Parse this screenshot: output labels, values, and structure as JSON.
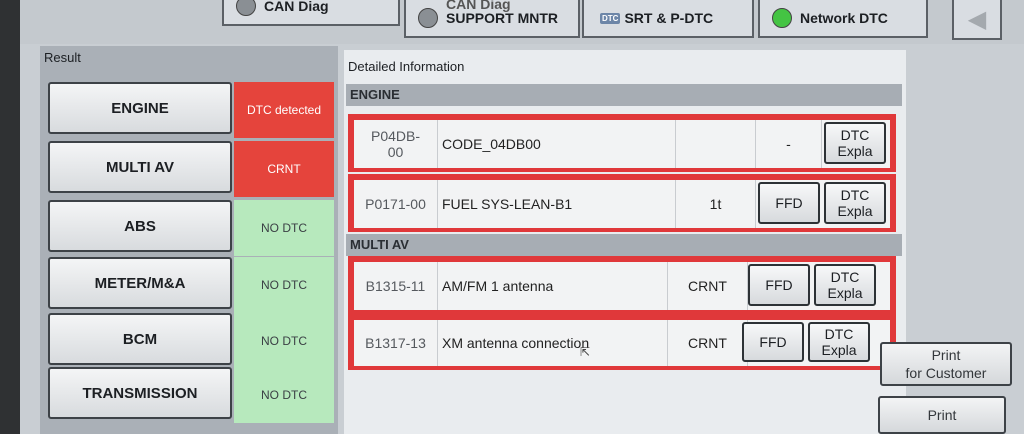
{
  "tabs": [
    {
      "label": "CAN Diag",
      "lamp_color": "#8a8f94"
    },
    {
      "label_line1": "CAN Diag",
      "label_line2": "SUPPORT MNTR",
      "lamp_color": "#8a8f94"
    },
    {
      "icon_text": "DTC",
      "label": "SRT & P-DTC"
    },
    {
      "label": "Network DTC",
      "lamp_color": "#44c443"
    }
  ],
  "result_panel": {
    "title": "Result",
    "rows": [
      {
        "ecu": "ENGINE",
        "status": "DTC detected",
        "status_color": "red"
      },
      {
        "ecu": "MULTI AV",
        "status": "CRNT",
        "status_color": "red"
      },
      {
        "ecu": "ABS",
        "status": "NO DTC",
        "status_color": "green"
      },
      {
        "ecu": "METER/M&A",
        "status": "NO DTC",
        "status_color": "green"
      },
      {
        "ecu": "BCM",
        "status": "NO DTC",
        "status_color": "green"
      },
      {
        "ecu": "TRANSMISSION",
        "status": "NO DTC",
        "status_color": "green"
      }
    ]
  },
  "detail_panel": {
    "title": "Detailed Information",
    "sections": [
      {
        "name": "ENGINE",
        "dtcs": [
          {
            "code_line1": "P04DB-",
            "code_line2": "00",
            "description": "CODE_04DB00",
            "status": "",
            "ffd_text": "-",
            "expla": "DTC Expla"
          },
          {
            "code": "P0171-00",
            "description": "FUEL SYS-LEAN-B1",
            "status": "1t",
            "ffd": "FFD",
            "expla": "DTC Expla"
          }
        ]
      },
      {
        "name": "MULTI AV",
        "dtcs": [
          {
            "code": "B1315-11",
            "description": "AM/FM 1 antenna",
            "status": "CRNT",
            "ffd": "FFD",
            "expla": "DTC Expla"
          },
          {
            "code": "B1317-13",
            "description": "XM antenna connection",
            "status": "CRNT",
            "ffd": "FFD",
            "expla": "DTC Expla"
          }
        ]
      }
    ]
  },
  "side_buttons": {
    "print_customer_line1": "Print",
    "print_customer_line2": "for Customer",
    "print": "Print"
  },
  "colors": {
    "dtc_red": "#e5443c",
    "nodtc_green": "#b7e9bd",
    "row_border_red": "#e0383a"
  }
}
